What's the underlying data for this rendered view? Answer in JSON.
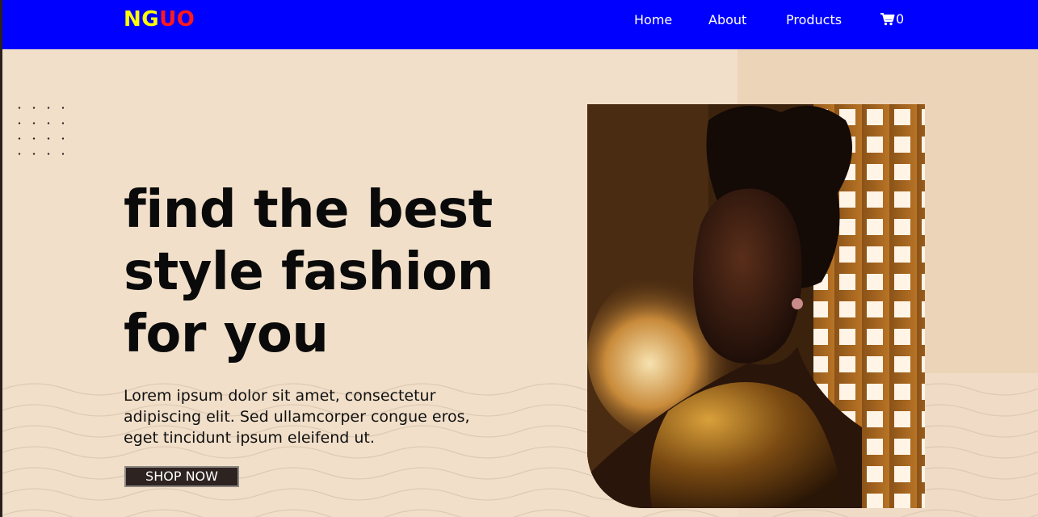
{
  "brand": {
    "logo_part1": "NG",
    "logo_part2": "UO"
  },
  "nav": {
    "items": [
      {
        "label": "Home"
      },
      {
        "label": "About"
      },
      {
        "label": "Products"
      }
    ],
    "cart_count": "0"
  },
  "hero": {
    "headline_line1": "find the best",
    "headline_line2": "style fashion",
    "headline_line3": "for you",
    "lead_line1": "Lorem ipsum dolor sit amet, consectetur",
    "lead_line2": "adipiscing elit. Sed ullamcorper congue eros,",
    "lead_line3": "eget tincidunt ipsum eleifend ut.",
    "cta_label": "SHOP NOW"
  },
  "colors": {
    "nav_bg": "#0000ff",
    "logo_yellow": "#ffff00",
    "logo_red": "#ff1a1a",
    "page_bg": "#f1dfc9",
    "button_bg": "#2d2321"
  },
  "icons": {
    "cart": "shopping-cart-icon"
  }
}
